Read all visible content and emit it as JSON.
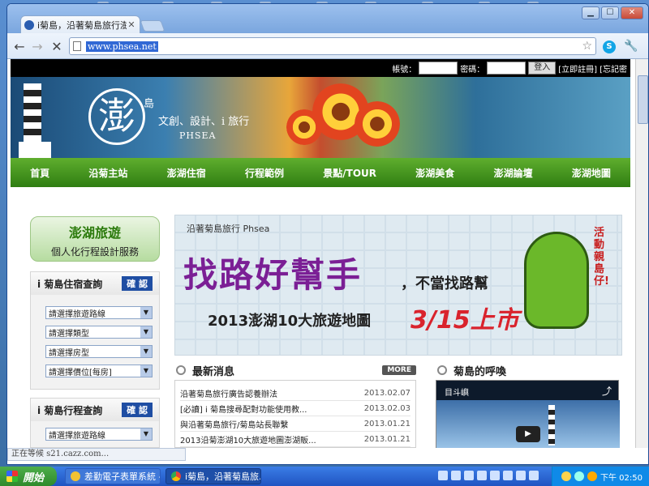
{
  "browser": {
    "tab_title": "i菊島，沿著菊島旅行澎湖",
    "tab_close": "✕",
    "url": "www.phsea.net",
    "window_min": "▁",
    "window_max": "☐",
    "window_close": "✕",
    "status_text": "正在等候 s21.cazz.com..."
  },
  "site": {
    "login": {
      "account_label": "帳號：",
      "password_label": "密碼：",
      "login_button": "登入",
      "register_link": "[立即註冊]",
      "forgot_link": "[忘記密"
    },
    "banner": {
      "logo_char": "澎",
      "logo_island": "島",
      "slogan": "文創、設計、i 旅行",
      "brand": "PHSEA"
    },
    "menu": [
      "首頁",
      "沿菊主站",
      "澎湖住宿",
      "行程範例",
      "景點/TOUR",
      "澎湖美食",
      "澎湖論壇",
      "澎湖地圖"
    ],
    "sidebar": {
      "category_title": "澎湖旅遊",
      "category_subtitle": "個人化行程設計服務",
      "lodging_panel": {
        "title": "i 菊島住宿查詢",
        "confirm": "確 認",
        "selects": [
          "請選擇旅遊路線",
          "請選擇類型",
          "請選擇房型",
          "請選擇價位[每房]"
        ]
      },
      "trip_panel": {
        "title": "i 菊島行程查詢",
        "confirm": "確 認",
        "selects": [
          "請選擇旅遊路線"
        ]
      }
    },
    "promo": {
      "brand": "沿著菊島旅行 Phsea",
      "headline": "找路好幫手",
      "headline_tail": "，不當找路幫",
      "subline": "2013澎湖10大旅遊地圖",
      "date": "3/15上市",
      "side_text": "活動親島仔!"
    },
    "news": {
      "title": "最新消息",
      "more": "MORE",
      "items": [
        {
          "title": "沿著菊島旅行廣告認養辦法",
          "date": "2013.02.07"
        },
        {
          "title": "[必讀] i 菊島搜尋配對功能使用教...",
          "date": "2013.02.03"
        },
        {
          "title": "與沿著菊島旅行/菊島站長聯繫",
          "date": "2013.01.21"
        },
        {
          "title": "2013沿菊澎湖10大旅遊地圖澎湖販...",
          "date": "2013.01.21"
        }
      ]
    },
    "call": {
      "title": "菊島的呼喚",
      "video_title": "目斗嶼",
      "share": "⤴",
      "play": "▶"
    }
  },
  "taskbar": {
    "start_label": "開始",
    "tasks": [
      {
        "label": "差勤電子表單系統 - ...",
        "color": "#f1c232"
      },
      {
        "label": "i菊島，沿著菊島旅...",
        "color": "#ea4335"
      }
    ],
    "clock": "下午 02:50"
  },
  "colors": {
    "menu_green": "#2f7e12",
    "confirm_blue": "#1f4ea3",
    "promo_red": "#d9232d"
  }
}
